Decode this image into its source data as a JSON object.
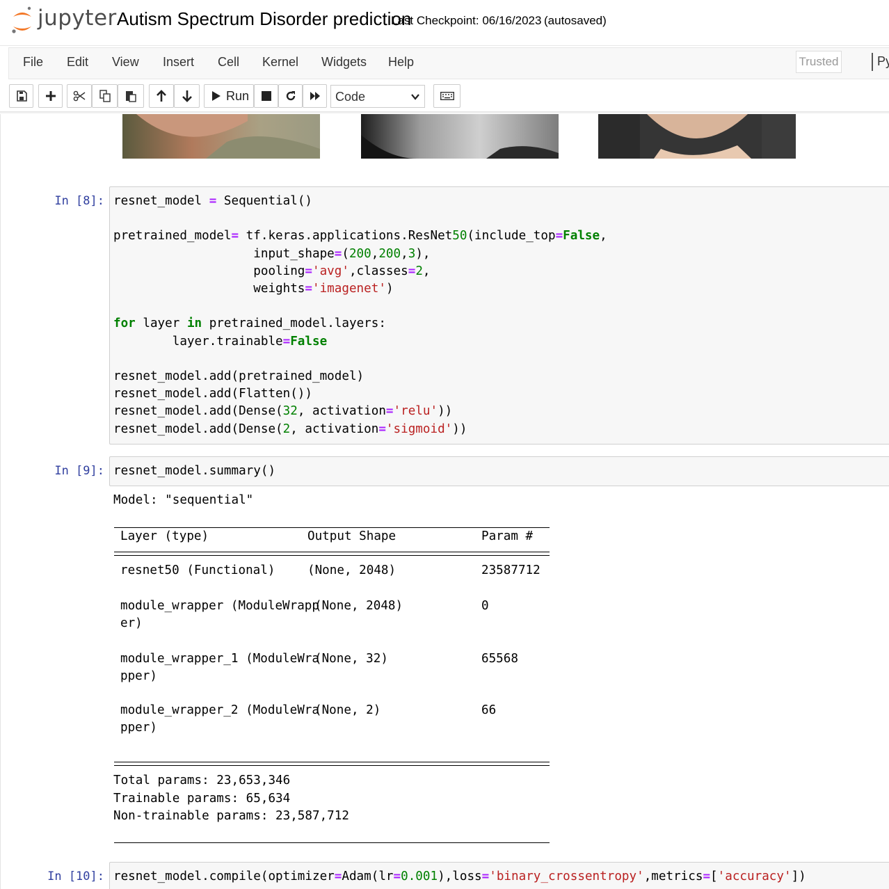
{
  "header": {
    "logo_text": "jupyter",
    "notebook_title": "Autism Spectrum Disorder prediction",
    "checkpoint": "Last Checkpoint: 06/16/2023",
    "autosave": "(autosaved)"
  },
  "menubar": {
    "items": [
      "File",
      "Edit",
      "View",
      "Insert",
      "Cell",
      "Kernel",
      "Widgets",
      "Help"
    ],
    "trusted": "Trusted",
    "kernel_name": "Py"
  },
  "toolbar": {
    "run_label": "Run",
    "cell_type": "Code",
    "icons": [
      "save-icon",
      "plus-icon",
      "cut-icon",
      "copy-icon",
      "paste-icon",
      "arrow-up-icon",
      "arrow-down-icon",
      "play-icon",
      "stop-icon",
      "restart-icon",
      "fast-forward-icon",
      "keyboard-icon"
    ]
  },
  "cells": {
    "c8": {
      "prompt": "In [8]:",
      "lines": [
        "resnet_model = Sequential()",
        "",
        "pretrained_model= tf.keras.applications.ResNet50(include_top=False,",
        "                   input_shape=(200,200,3),",
        "                   pooling='avg',classes=2,",
        "                   weights='imagenet')",
        "",
        "for layer in pretrained_model.layers:",
        "        layer.trainable=False",
        "",
        "resnet_model.add(pretrained_model)",
        "resnet_model.add(Flatten())",
        "resnet_model.add(Dense(32, activation='relu'))",
        "resnet_model.add(Dense(2, activation='sigmoid'))"
      ]
    },
    "c9": {
      "prompt": "In [9]:",
      "code": "resnet_model.summary()",
      "output": {
        "model_line": "Model: \"sequential\"",
        "headers": [
          "Layer (type)",
          "Output Shape",
          "Param #"
        ],
        "rows": [
          {
            "layer": "resnet50 (Functional)",
            "layer2": "",
            "shape": "(None, 2048)",
            "params": "23587712"
          },
          {
            "layer": "module_wrapper (ModuleWrapp",
            "layer2": "er)",
            "shape": "(None, 2048)",
            "params": "0"
          },
          {
            "layer": "module_wrapper_1 (ModuleWra",
            "layer2": "pper)",
            "shape": "(None, 32)",
            "params": "65568"
          },
          {
            "layer": "module_wrapper_2 (ModuleWra",
            "layer2": "pper)",
            "shape": "(None, 2)",
            "params": "66"
          }
        ],
        "total": "Total params: 23,653,346",
        "trainable": "Trainable params: 65,634",
        "non_trainable": "Non-trainable params: 23,587,712"
      }
    },
    "c10": {
      "prompt": "In [10]:",
      "code": "resnet_model.compile(optimizer=Adam(lr=0.001),loss='binary_crossentropy',metrics=['accuracy'])"
    }
  }
}
